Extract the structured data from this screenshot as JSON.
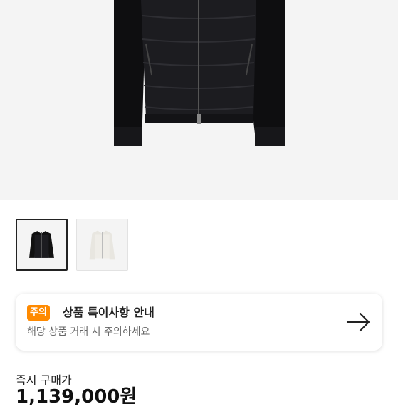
{
  "product": {
    "image_main": "black-padded-knit-jacket",
    "thumbnails": [
      {
        "name": "black-jacket",
        "selected": true
      },
      {
        "name": "white-jacket",
        "selected": false
      }
    ]
  },
  "notice": {
    "tag": "주의",
    "title": "상품 특이사항 안내",
    "subtitle": "해당 상품 거래 시 주의하세요",
    "icon": "arrow-right-icon",
    "tag_color": "#ff8a00"
  },
  "price": {
    "label": "즉시 구매가",
    "value": "1,139,000원"
  }
}
